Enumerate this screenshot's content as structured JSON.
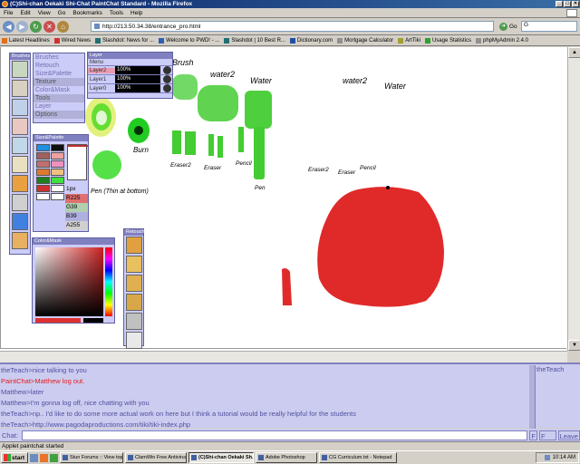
{
  "window": {
    "title": "(C)Shi-chan Oekaki Shi-Chat PaintChat Standard - Mozilla Firefox",
    "controls": [
      "_",
      "□",
      "×"
    ]
  },
  "menu": [
    "File",
    "Edit",
    "View",
    "Go",
    "Bookmarks",
    "Tools",
    "Help"
  ],
  "nav": {
    "url": "http://213.50.34.38/entrance_pro.html",
    "go_label": "Go",
    "search_value": "G"
  },
  "bookmarks": [
    {
      "label": "Latest Headlines",
      "color": "#e07020"
    },
    {
      "label": "Wired News",
      "color": "#d03030"
    },
    {
      "label": "Slashdot: News for ...",
      "color": "#207070"
    },
    {
      "label": "Welcome to PWD! - ...",
      "color": "#3060b0"
    },
    {
      "label": "Slashdot | 10 Best R...",
      "color": "#207070"
    },
    {
      "label": "Dictionary.com",
      "color": "#2050a0"
    },
    {
      "label": "Mortgage Calculator",
      "color": "#909090"
    },
    {
      "label": "ArtTiki",
      "color": "#a0a030"
    },
    {
      "label": "Usage Statistics",
      "color": "#30a030"
    },
    {
      "label": "phpMyAdmin 2.4.0",
      "color": "#909090"
    }
  ],
  "palettes": {
    "tools_title": "Brushes",
    "menu_items": [
      {
        "label": "Brushes",
        "selected": false
      },
      {
        "label": "Retouch",
        "selected": false
      },
      {
        "label": "Size&Palette",
        "selected": false
      },
      {
        "label": "Texture",
        "selected": true
      },
      {
        "label": "Color&Mask",
        "selected": false
      },
      {
        "label": "Tools",
        "selected": true
      },
      {
        "label": "Layer",
        "selected": false
      },
      {
        "label": "Options",
        "selected": true
      }
    ],
    "layer_title": "Layer",
    "layer_menu": "Menu",
    "layers": [
      {
        "name": "Layer2",
        "alpha": "100%",
        "active": true
      },
      {
        "name": "Layer1",
        "alpha": "100%",
        "active": false
      },
      {
        "name": "Layer0",
        "alpha": "100%",
        "active": false
      }
    ],
    "size_title": "Size&Palette",
    "swatches": [
      "#2090e0",
      "#101010",
      "#a06060",
      "#f0a0a0",
      "#c07070",
      "#f090c0",
      "#e07830",
      "#f0c080",
      "#208020",
      "#40e040",
      "#d03030",
      "#ffffff",
      "#ffffff",
      "#ffffff"
    ],
    "size_value": "1px",
    "rgba": [
      "R225",
      "G39",
      "B39",
      "A255"
    ],
    "colormask_title": "Color&Mask",
    "retouch_title": "Retouch"
  },
  "painting": {
    "labels": {
      "brush": "Brush",
      "water": "Water",
      "water2": "water2",
      "burn": "Burn",
      "erasers": "Eraser2",
      "eraser": "Eraser",
      "pencil": "Pencil",
      "pen": "Pen",
      "thin": "Pen (Thin at bottom)"
    },
    "colors": {
      "green": "#44cc33",
      "red": "#e02a2a",
      "yellow_green": "#ddee66"
    }
  },
  "chat": {
    "lines": [
      {
        "text": "theTeach>nice talking to you",
        "type": "msg"
      },
      {
        "text": "PaintChat>Matthew log out.",
        "type": "sys"
      },
      {
        "text": "Matthew>later",
        "type": "msg"
      },
      {
        "text": "Matthew>I'm gonna log off, nice chatting with you",
        "type": "msg"
      },
      {
        "text": "theTeach>np.. I'd like to do some more actual work on here but I think a tutorial would be really helpful for the students",
        "type": "msg"
      },
      {
        "text": "theTeach>http://www.pagodaproductions.com/tiki/tiki-index.php",
        "type": "msg"
      }
    ],
    "users": [
      "theTeach"
    ],
    "input_label": "Chat:",
    "buttons": [
      "F",
      "F All",
      "Leave"
    ]
  },
  "status": "Applet paintchat started",
  "taskbar": {
    "start": "start",
    "tasks": [
      {
        "label": "Stun Forums :: View topic...",
        "active": false
      },
      {
        "label": "ClamWin Free Antivirus",
        "active": false
      },
      {
        "label": "(C)Shi-chan Oekaki Sh...",
        "active": true
      },
      {
        "label": "Adobe Photoshop",
        "active": false
      },
      {
        "label": "CG Curriculum.txt - Notepad",
        "active": false
      }
    ],
    "clock": "10:14 AM"
  }
}
